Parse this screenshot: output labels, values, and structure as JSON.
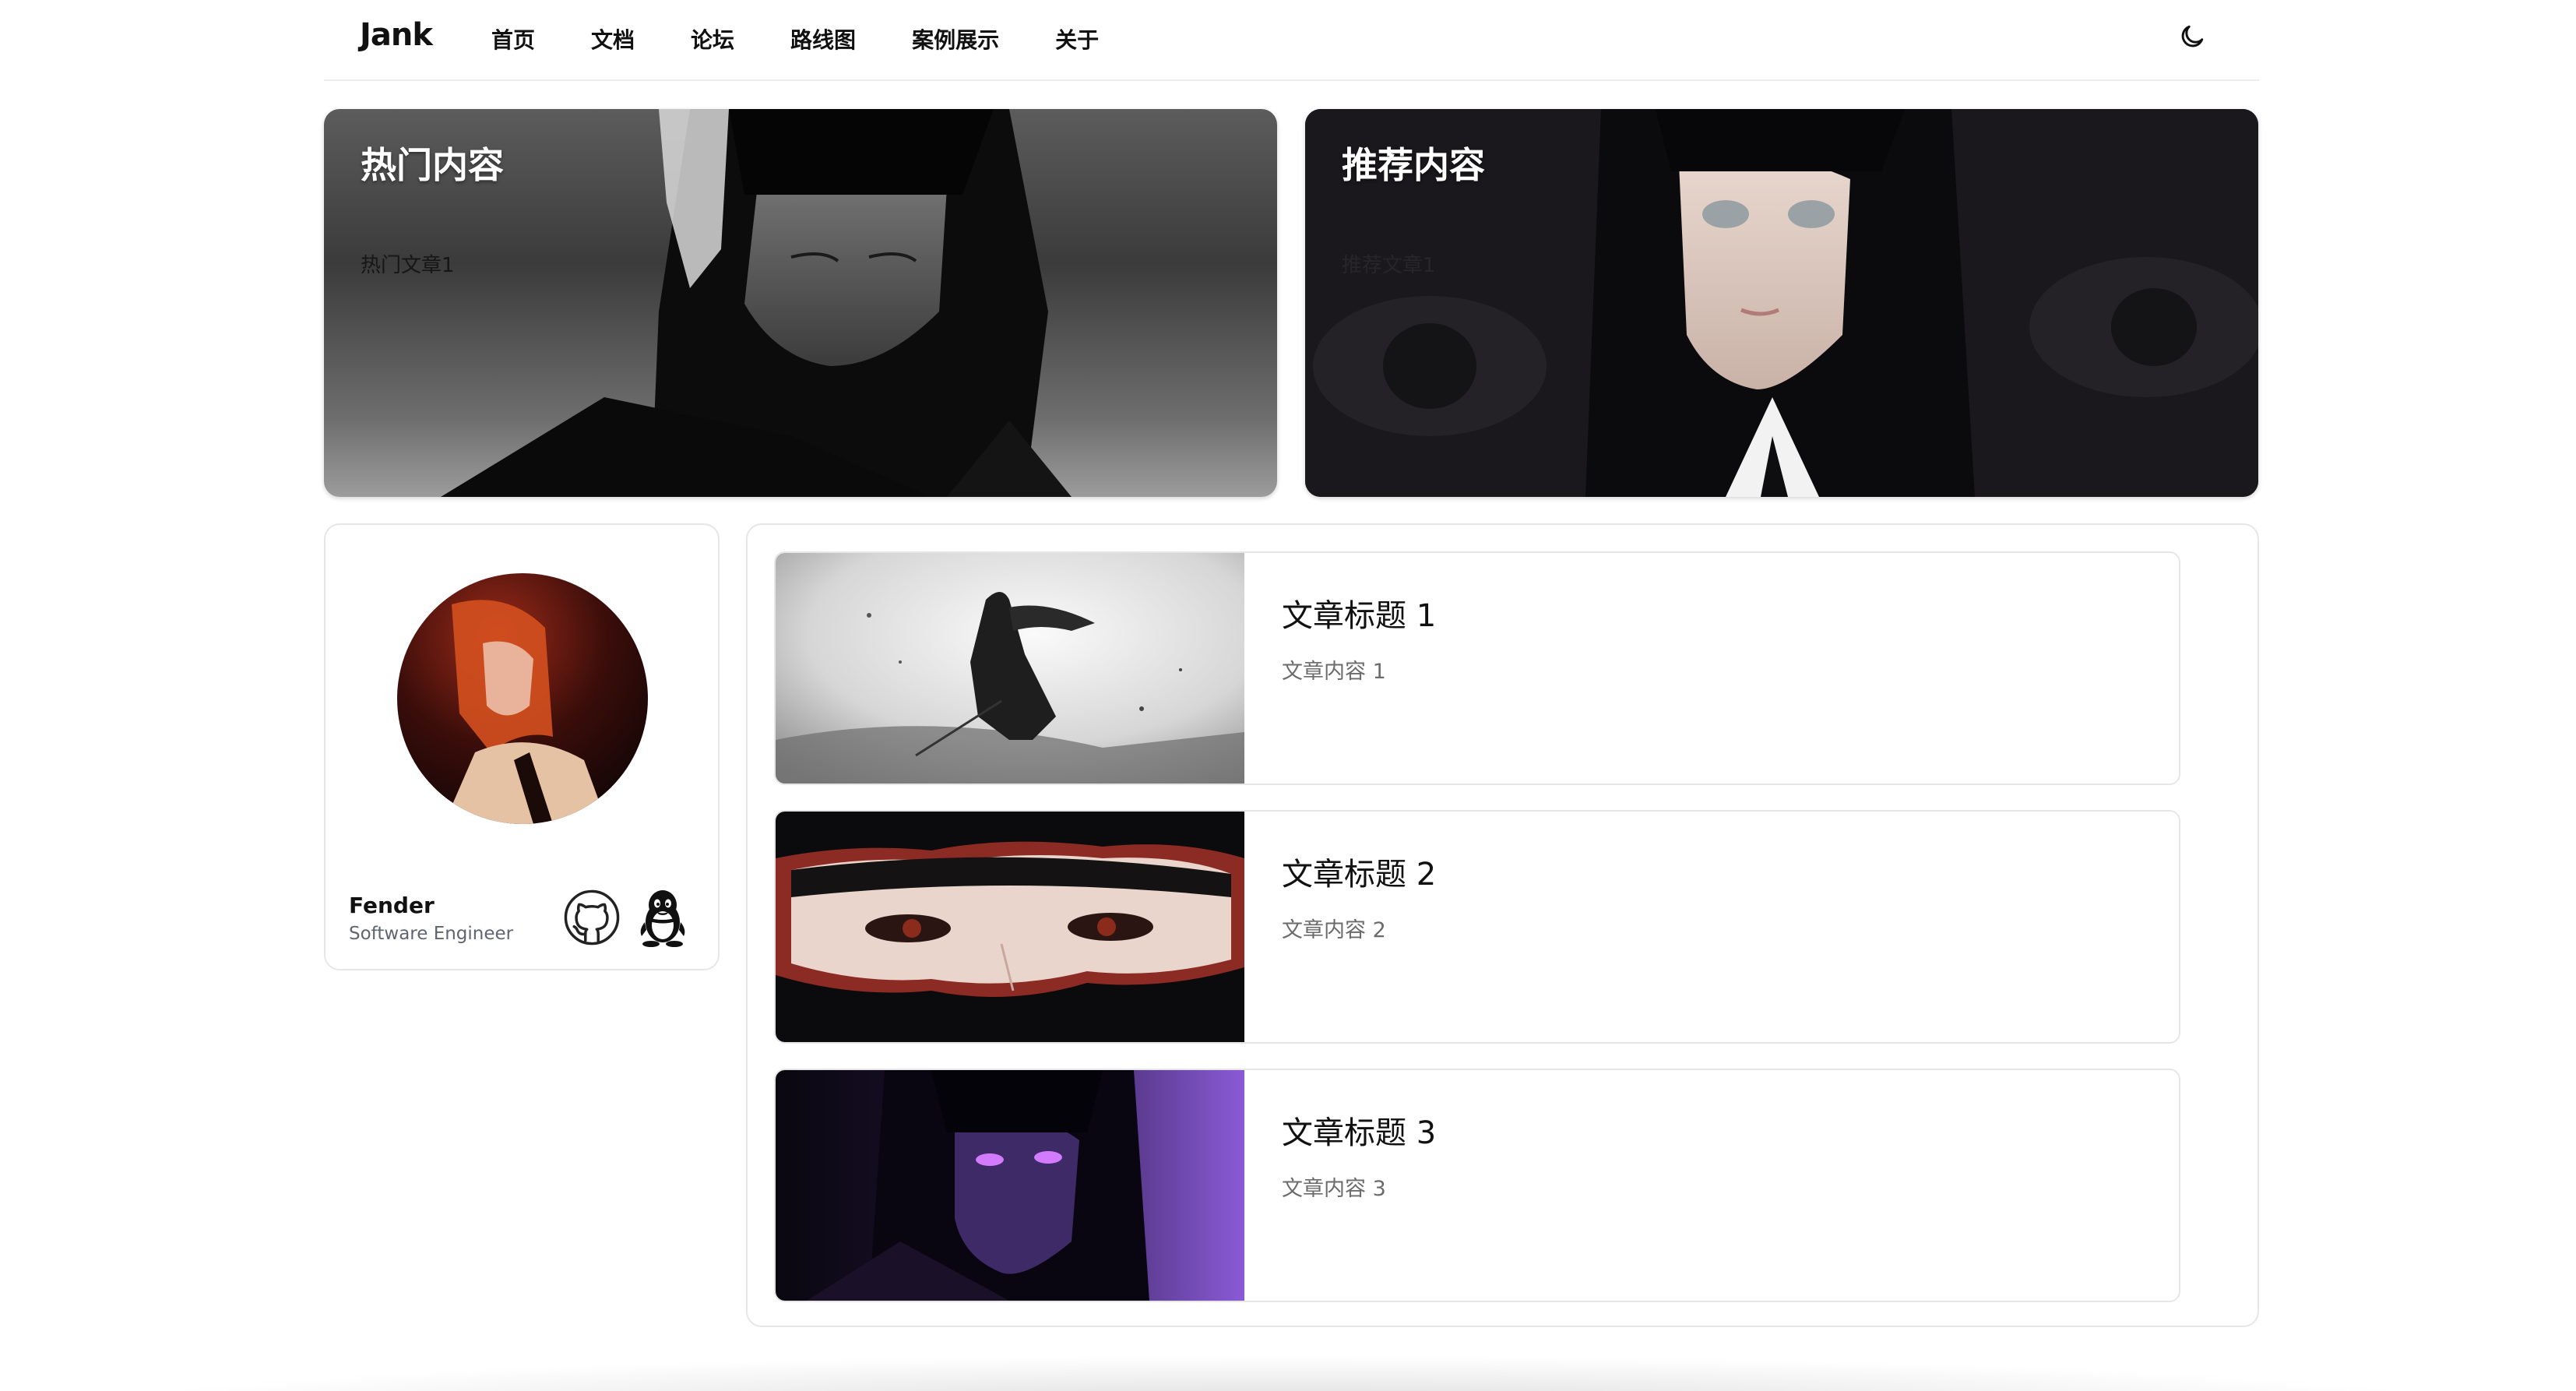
{
  "header": {
    "logo": "Jank",
    "nav": [
      "首页",
      "文档",
      "论坛",
      "路线图",
      "案例展示",
      "关于"
    ],
    "theme_icon": "moon-icon"
  },
  "hero": {
    "hot": {
      "title": "热门内容",
      "item": "热门文章1"
    },
    "recommended": {
      "title": "推荐内容",
      "item": "推荐文章1"
    }
  },
  "profile": {
    "name": "Fender",
    "role": "Software Engineer",
    "social_icons": [
      "github-icon",
      "qq-icon"
    ]
  },
  "articles": [
    {
      "title": "文章标题 1",
      "excerpt": "文章内容 1"
    },
    {
      "title": "文章标题 2",
      "excerpt": "文章内容 2"
    },
    {
      "title": "文章标题 3",
      "excerpt": "文章内容 3"
    }
  ]
}
